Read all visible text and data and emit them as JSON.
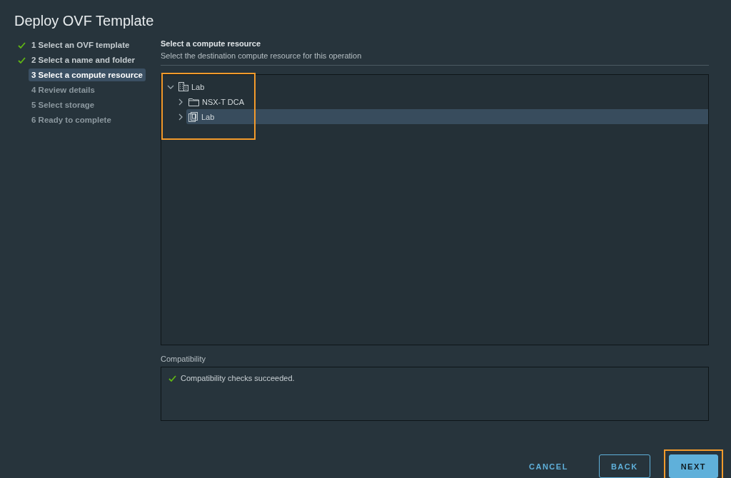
{
  "window": {
    "title": "Deploy OVF Template"
  },
  "steps": [
    {
      "label": "1 Select an OVF template",
      "done": true,
      "disabled": false,
      "selected": false
    },
    {
      "label": "2 Select a name and folder",
      "done": true,
      "disabled": false,
      "selected": false
    },
    {
      "label": "3 Select a compute resource",
      "done": false,
      "disabled": false,
      "selected": true
    },
    {
      "label": "4 Review details",
      "done": false,
      "disabled": true,
      "selected": false
    },
    {
      "label": "5 Select storage",
      "done": false,
      "disabled": true,
      "selected": false
    },
    {
      "label": "6 Ready to complete",
      "done": false,
      "disabled": true,
      "selected": false
    }
  ],
  "page": {
    "heading": "Select a compute resource",
    "subtitle": "Select the destination compute resource for this operation"
  },
  "tree": [
    {
      "label": "Lab",
      "kind": "datacenter",
      "expanded": true,
      "selected": false,
      "children": [
        {
          "label": "NSX-T DCA",
          "kind": "folder",
          "expanded": false,
          "selected": false
        },
        {
          "label": "Lab",
          "kind": "cluster",
          "expanded": false,
          "selected": true
        }
      ]
    }
  ],
  "compatibility": {
    "label": "Compatibility",
    "message": "Compatibility checks succeeded.",
    "ok": true
  },
  "buttons": [
    {
      "label": "CANCEL",
      "kind": "flat",
      "highlighted": false
    },
    {
      "label": "BACK",
      "kind": "outline",
      "highlighted": false
    },
    {
      "label": "NEXT",
      "kind": "primary",
      "highlighted": true
    }
  ]
}
